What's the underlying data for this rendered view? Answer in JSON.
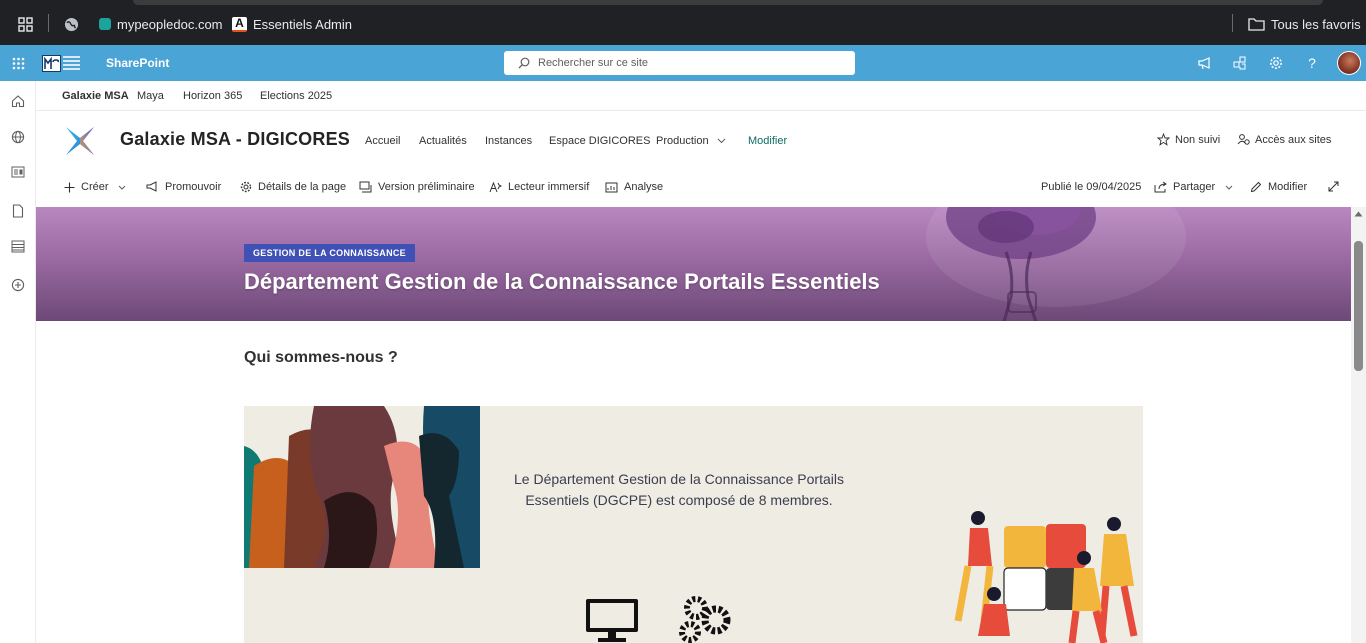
{
  "browser": {
    "bookmarks": [
      "mypeopledoc.com",
      "Essentiels Admin"
    ],
    "all_favorites": "Tous les favoris"
  },
  "suite": {
    "brand": "SharePoint",
    "search_placeholder": "Rechercher sur ce site"
  },
  "hub_nav": [
    "Galaxie MSA",
    "Maya",
    "Horizon 365",
    "Elections 2025"
  ],
  "site": {
    "title": "Galaxie MSA - DIGICORES",
    "nav": [
      "Accueil",
      "Actualités",
      "Instances",
      "Espace DIGICORES",
      "Production"
    ],
    "edit_link": "Modifier",
    "follow": "Non suivi",
    "site_access": "Accès aux sites"
  },
  "commands": {
    "create": "Créer",
    "promote": "Promouvoir",
    "page_details": "Détails de la page",
    "draft": "Version préliminaire",
    "reader": "Lecteur immersif",
    "analytics": "Analyse",
    "published": "Publié le 09/04/2025",
    "share": "Partager",
    "edit": "Modifier"
  },
  "banner": {
    "topic": "GESTION DE LA CONNAISSANCE",
    "title": "Département Gestion de la Connaissance Portails Essentiels"
  },
  "content": {
    "section_title": "Qui sommes-nous ?",
    "hero_text": "Le Département Gestion de la Connaissance Portails Essentiels (DGCPE) est composé de 8 membres."
  },
  "colors": {
    "suite_bar": "#4ba4d6",
    "topic_badge": "#3f51b5",
    "edit_link": "#0f6c64"
  }
}
